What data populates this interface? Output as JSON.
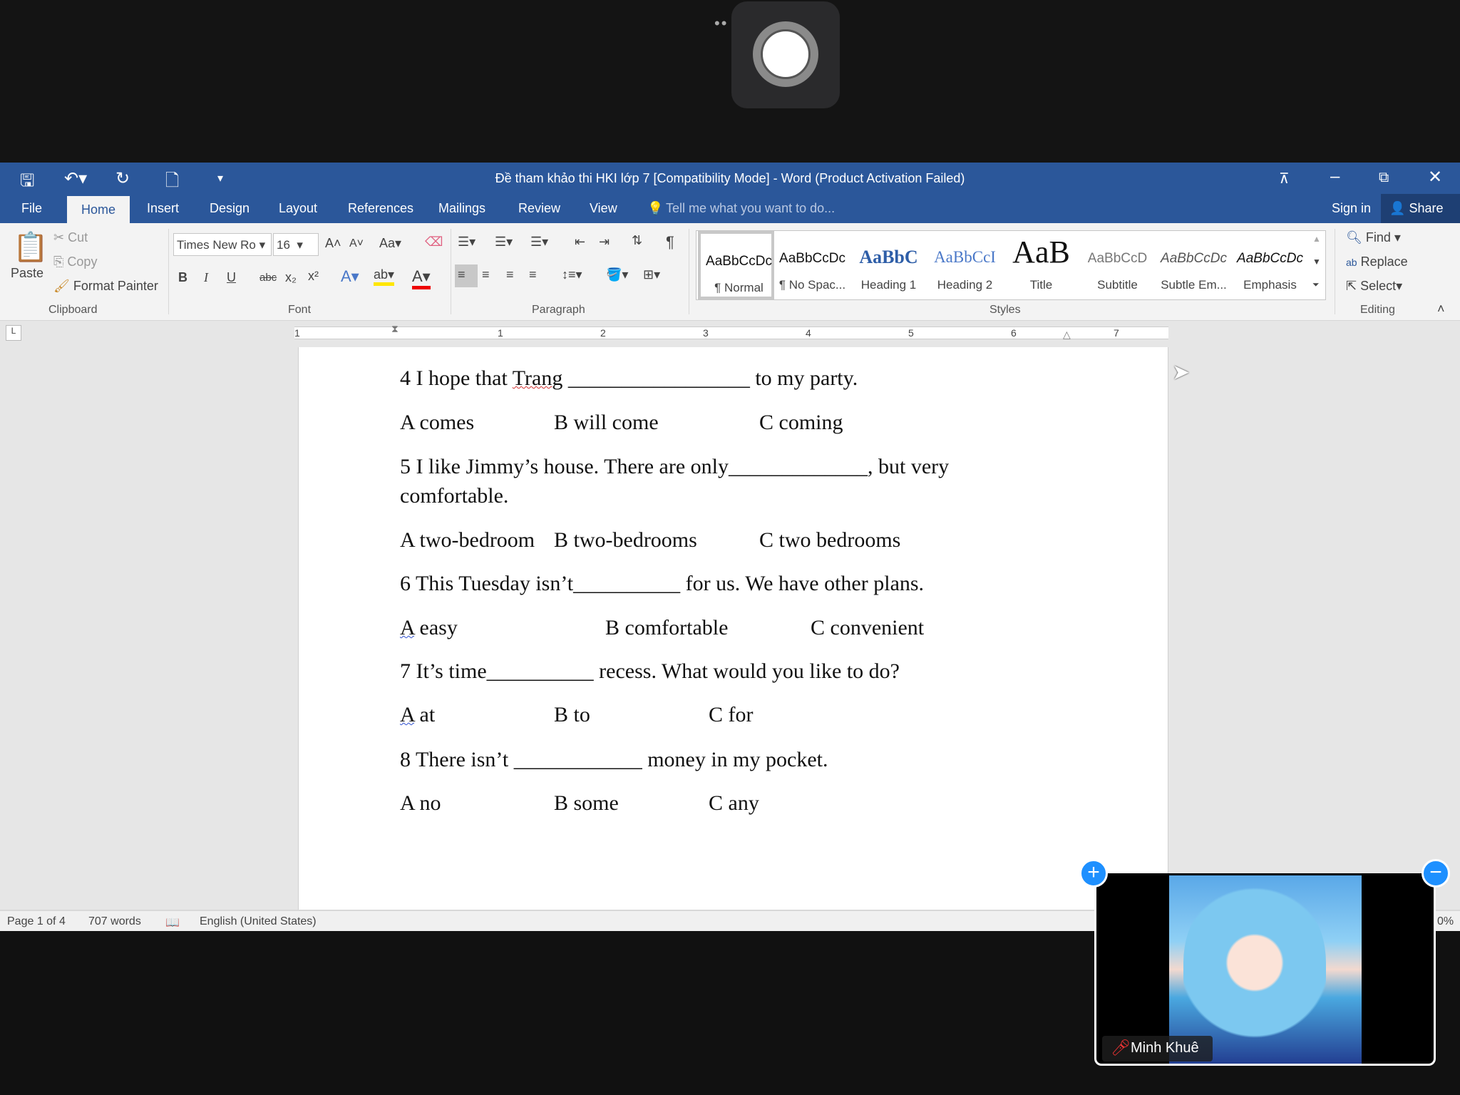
{
  "colors": {
    "word_blue": "#2b579a",
    "record_bg": "#2a2a2c",
    "badge_blue": "#1e90ff"
  },
  "titlebar": {
    "title": "Đề tham khảo thi HKI lớp 7 [Compatibility Mode] - Word (Product Activation Failed)",
    "icons": [
      "save-icon",
      "undo-icon",
      "redo-icon",
      "new-document-icon",
      "customize-qat-icon",
      "ribbon-display-icon",
      "minimize-icon",
      "restore-icon",
      "close-icon"
    ]
  },
  "tabs": [
    "File",
    "Home",
    "Insert",
    "Design",
    "Layout",
    "References",
    "Mailings",
    "Review",
    "View"
  ],
  "active_tab": "Home",
  "tell_me": "Tell me what you want to do...",
  "sign_in": "Sign in",
  "share": "Share",
  "clipboard": {
    "paste": "Paste",
    "cut": "Cut",
    "copy": "Copy",
    "format_painter": "Format Painter",
    "group": "Clipboard"
  },
  "font": {
    "name": "Times New Ro",
    "size": "16",
    "case": "Aa",
    "group": "Font",
    "bold": "B",
    "italic": "I",
    "underline": "U",
    "strike": "abc",
    "sub": "x₂",
    "sup": "x²"
  },
  "paragraph": {
    "group": "Paragraph"
  },
  "styles": {
    "group": "Styles",
    "items": [
      {
        "preview": "AaBbCcDc",
        "name": "¶ Normal"
      },
      {
        "preview": "AaBbCcDc",
        "name": "¶ No Spac..."
      },
      {
        "preview": "AaBbC",
        "name": "Heading 1"
      },
      {
        "preview": "AaBbCcI",
        "name": "Heading 2"
      },
      {
        "preview": "AaB",
        "name": "Title"
      },
      {
        "preview": "AaBbCcD",
        "name": "Subtitle"
      },
      {
        "preview": "AaBbCcDc",
        "name": "Subtle Em..."
      },
      {
        "preview": "AaBbCcDc",
        "name": "Emphasis"
      }
    ]
  },
  "editing": {
    "find": "Find",
    "replace": "Replace",
    "select": "Select",
    "group": "Editing"
  },
  "ruler": [
    "1",
    "1",
    "2",
    "3",
    "4",
    "5",
    "6",
    "7"
  ],
  "document": {
    "q4": {
      "pre": "4 I hope that ",
      "word": "Trang",
      "post": " _________________ to my party.",
      "a": "A comes",
      "b": "B will come",
      "c": "C coming"
    },
    "q5": {
      "line1": "5 I like Jimmy’s house. There are only_____________, but very",
      "line2": "comfortable.",
      "a": "A two-bedroom",
      "b": "B two-bedrooms",
      "c": "C two bedrooms"
    },
    "q6": {
      "text": "6 This Tuesday isn’t__________ for us. We have other plans.",
      "a_letter": "A",
      "a": " easy",
      "b": "B comfortable",
      "c": "C convenient"
    },
    "q7": {
      "text": "7 It’s time__________ recess. What would you like to do?",
      "a_letter": "A",
      "a": " at",
      "b": "B to",
      "c": "C for"
    },
    "q8": {
      "text": "8 There isn’t ____________ money in my pocket.",
      "a": "A no",
      "b": "B some",
      "c": "C any"
    }
  },
  "status": {
    "page": "Page 1 of 4",
    "words": "707 words",
    "language": "English (United States)",
    "zoom_partial": "0%"
  },
  "video": {
    "participant": "Minh Khuê",
    "mic": "muted"
  }
}
